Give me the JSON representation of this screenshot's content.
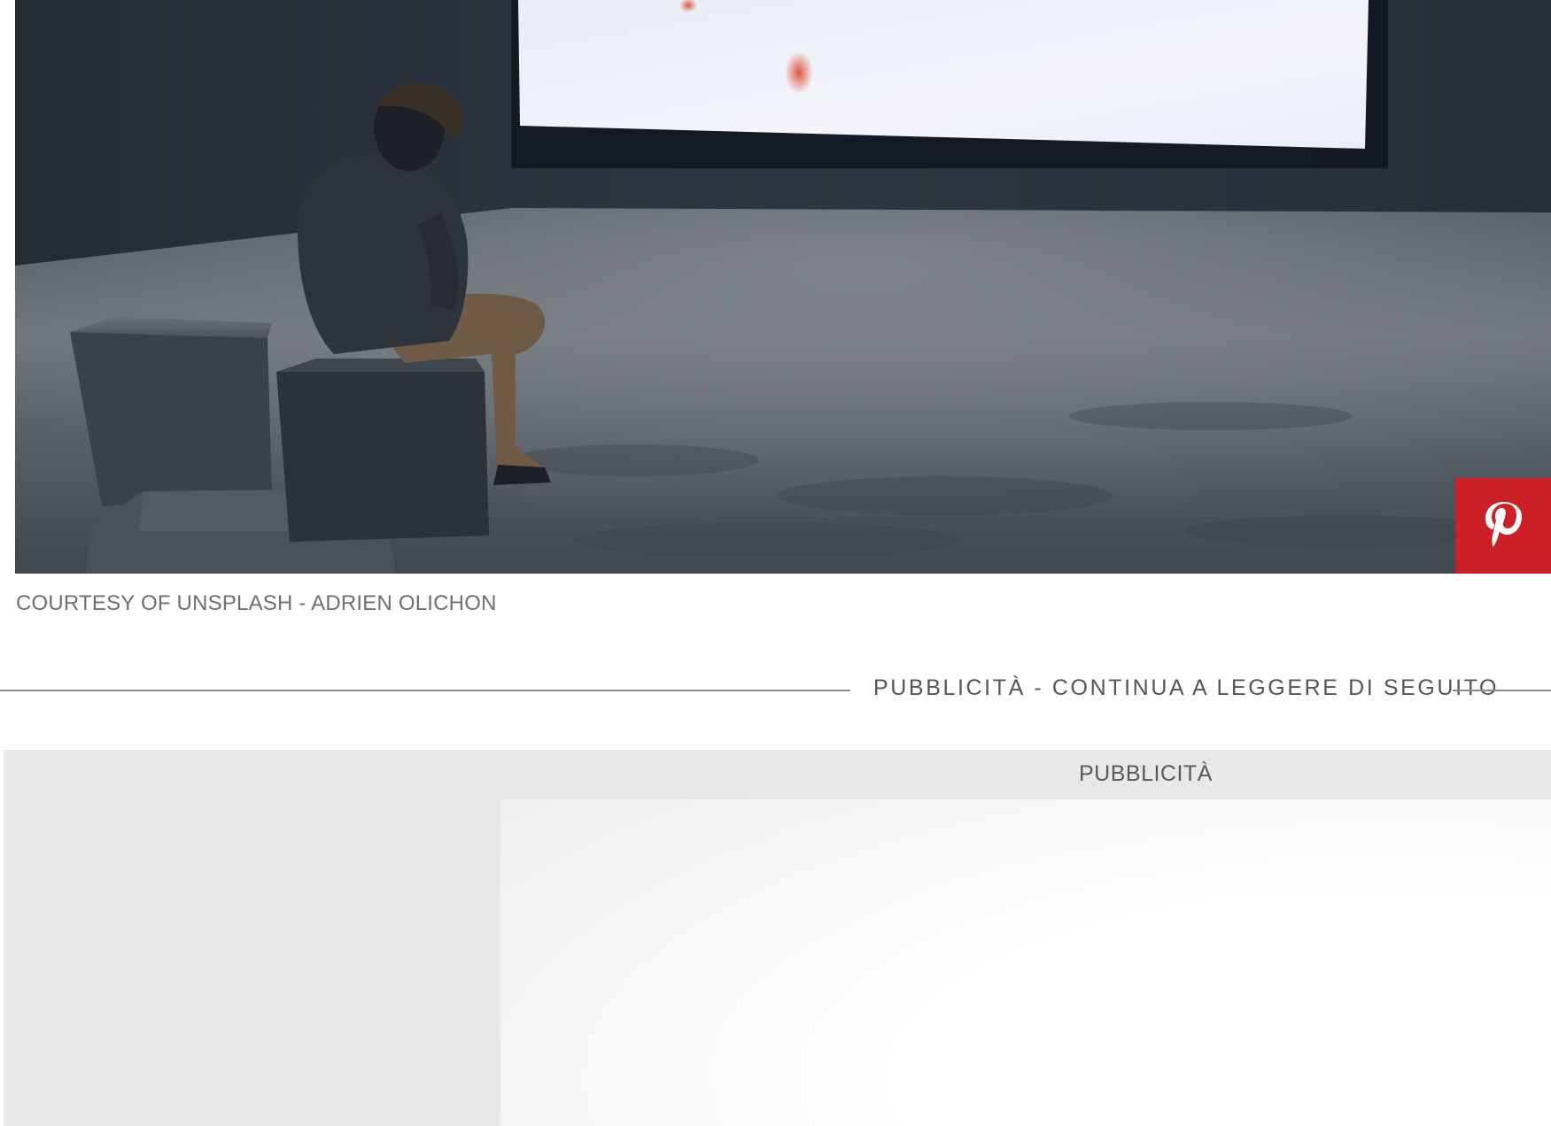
{
  "image": {
    "alt": "",
    "colors": {
      "wall": "#2b333c",
      "floor": "#5c646c",
      "screen": "#eef0f6",
      "accent_dots": "#e2573d"
    }
  },
  "pinterest_button": {
    "icon": "pinterest-icon",
    "background": "#cc2026"
  },
  "caption": "COURTESY OF UNSPLASH - ADRIEN OLICHON",
  "ad_divider": {
    "text": "PUBBLICITÀ - CONTINUA A LEGGERE DI SEGUITO"
  },
  "ad_box": {
    "label": "PUBBLICITÀ",
    "background": "#e8e8e8"
  }
}
